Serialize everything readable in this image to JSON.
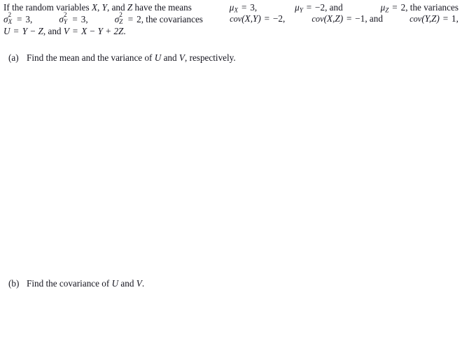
{
  "document": {
    "type": "textbook-exercise",
    "background_color": "#ffffff",
    "text_color": "#14141e"
  },
  "statement": {
    "line1": {
      "intro": "If the random variables ",
      "var_x": "X",
      "sep1": ", ",
      "var_y": "Y",
      "sep2": ", and ",
      "var_z": "Z",
      "mid": " have the means ",
      "mu_x_symbol": "μ",
      "mu_x_sub": "X",
      "mu_x_eq": " = ",
      "mu_x_value": "3",
      "sep3": ", ",
      "mu_y_symbol": "μ",
      "mu_y_sub": "Y",
      "mu_y_eq": " = ",
      "mu_y_value": "−2",
      "sep4": ", and ",
      "mu_z_symbol": "μ",
      "mu_z_sub": "Z",
      "mu_z_eq": " = ",
      "mu_z_value": "2",
      "tail": ", the variances"
    },
    "line2": {
      "sigma_symbol": "σ",
      "sigma_sup": "2",
      "sigma_x_sub": "X",
      "sigma_x_eq": " = ",
      "sigma_x_value": "3",
      "sep1": ", ",
      "sigma_y_sub": "Y",
      "sigma_y_eq": " = ",
      "sigma_y_value": "3",
      "sep2": ", ",
      "sigma_z_sub": "Z",
      "sigma_z_eq": " = ",
      "sigma_z_value": "2",
      "mid": ", the covariances ",
      "cov_name": "cov",
      "cov_xy_args": "(X,Y)",
      "cov_xy_eq": " = ",
      "cov_xy_value": "−2",
      "sep3": ", ",
      "cov_xz_args": "(X,Z)",
      "cov_xz_eq": " = ",
      "cov_xz_value": "−1",
      "sep4": ", and ",
      "cov_yz_args": "(Y,Z)",
      "cov_yz_eq": " = ",
      "cov_yz_value": "1",
      "tail": ","
    },
    "line3": {
      "u_def_lhs": "U",
      "u_def_eq": " = ",
      "u_def_rhs": "Y − Z",
      "conj": ", and ",
      "v_def_lhs": "V",
      "v_def_eq": " = ",
      "v_def_rhs": "X − Y + 2Z",
      "period": "."
    },
    "plain_text": "If the random variables X, Y, and Z have the means μX = 3, μY = −2, and μZ = 2, the variances σ²X = 3, σ²Y = 3, σ²Z = 2, the covariances cov(X,Y) = −2, cov(X,Z) = −1, and cov(Y,Z) = 1, U = Y − Z, and V = X − Y + 2Z."
  },
  "parts": [
    {
      "label": "(a)",
      "text_before": "Find the mean and the variance of ",
      "var_1": "U",
      "text_mid": " and ",
      "var_2": "V",
      "text_after": ", respectively.",
      "plain_text": "(a)  Find the mean and the variance of U and V, respectively."
    },
    {
      "label": "(b)",
      "text_before": "Find the covariance of ",
      "var_1": "U",
      "text_mid": " and ",
      "var_2": "V",
      "text_after": ".",
      "plain_text": "(b)  Find the covariance of U and V."
    }
  ]
}
